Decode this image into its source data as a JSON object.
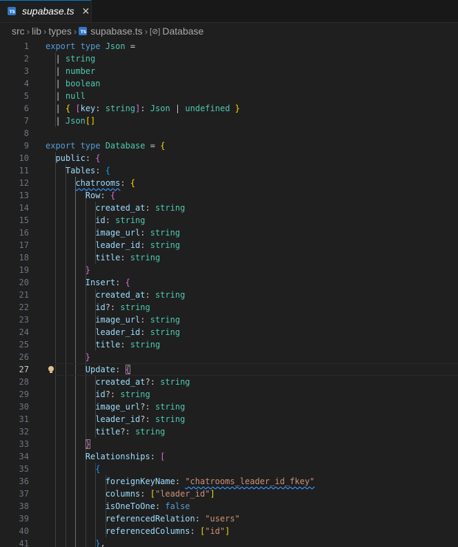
{
  "tab": {
    "title": "supabase.ts",
    "close": "✕",
    "file_icon": "TS"
  },
  "breadcrumb": {
    "items": [
      "src",
      "lib",
      "types",
      "supabase.ts",
      "Database"
    ],
    "symbol_icon": "[⊘]"
  },
  "editor": {
    "current_line": 27,
    "lines": [
      {
        "n": "1",
        "t": [
          [
            "kw",
            "export "
          ],
          [
            "kw",
            "type "
          ],
          [
            "ty",
            "Json"
          ],
          [
            "pu",
            " ="
          ]
        ]
      },
      {
        "n": "2",
        "t": [
          [
            "pu",
            "  | "
          ],
          [
            "ty",
            "string"
          ]
        ]
      },
      {
        "n": "3",
        "t": [
          [
            "pu",
            "  | "
          ],
          [
            "ty",
            "number"
          ]
        ]
      },
      {
        "n": "4",
        "t": [
          [
            "pu",
            "  | "
          ],
          [
            "ty",
            "boolean"
          ]
        ]
      },
      {
        "n": "5",
        "t": [
          [
            "pu",
            "  | "
          ],
          [
            "ty",
            "null"
          ]
        ]
      },
      {
        "n": "6",
        "t": [
          [
            "pu",
            "  | "
          ],
          [
            "b1",
            "{"
          ],
          [
            "pu",
            " "
          ],
          [
            "b2",
            "["
          ],
          [
            "pr",
            "key"
          ],
          [
            "pu",
            ": "
          ],
          [
            "ty",
            "string"
          ],
          [
            "b2",
            "]"
          ],
          [
            "pu",
            ": "
          ],
          [
            "ty",
            "Json"
          ],
          [
            "pu",
            " | "
          ],
          [
            "ty",
            "undefined"
          ],
          [
            "pu",
            " "
          ],
          [
            "b1",
            "}"
          ]
        ]
      },
      {
        "n": "7",
        "t": [
          [
            "pu",
            "  | "
          ],
          [
            "ty",
            "Json"
          ],
          [
            "b1",
            "[]"
          ]
        ]
      },
      {
        "n": "8",
        "t": []
      },
      {
        "n": "9",
        "t": [
          [
            "kw",
            "export "
          ],
          [
            "kw",
            "type "
          ],
          [
            "ty",
            "Database"
          ],
          [
            "pu",
            " = "
          ],
          [
            "b1",
            "{"
          ]
        ]
      },
      {
        "n": "10",
        "t": [
          [
            "pu",
            "  "
          ],
          [
            "pr",
            "public"
          ],
          [
            "pu",
            ": "
          ],
          [
            "b2",
            "{"
          ]
        ]
      },
      {
        "n": "11",
        "t": [
          [
            "pu",
            "    "
          ],
          [
            "pr",
            "Tables"
          ],
          [
            "pu",
            ": "
          ],
          [
            "b3",
            "{"
          ]
        ]
      },
      {
        "n": "12",
        "t": [
          [
            "pu",
            "      "
          ],
          [
            "pr wavy",
            "chatrooms"
          ],
          [
            "pu",
            ": "
          ],
          [
            "b1",
            "{"
          ]
        ]
      },
      {
        "n": "13",
        "t": [
          [
            "pu",
            "        "
          ],
          [
            "pr",
            "Row"
          ],
          [
            "pu",
            ": "
          ],
          [
            "b2",
            "{"
          ]
        ]
      },
      {
        "n": "14",
        "t": [
          [
            "pu",
            "          "
          ],
          [
            "pr",
            "created_at"
          ],
          [
            "pu",
            ": "
          ],
          [
            "ty",
            "string"
          ]
        ]
      },
      {
        "n": "15",
        "t": [
          [
            "pu",
            "          "
          ],
          [
            "pr",
            "id"
          ],
          [
            "pu",
            ": "
          ],
          [
            "ty",
            "string"
          ]
        ]
      },
      {
        "n": "16",
        "t": [
          [
            "pu",
            "          "
          ],
          [
            "pr",
            "image_url"
          ],
          [
            "pu",
            ": "
          ],
          [
            "ty",
            "string"
          ]
        ]
      },
      {
        "n": "17",
        "t": [
          [
            "pu",
            "          "
          ],
          [
            "pr",
            "leader_id"
          ],
          [
            "pu",
            ": "
          ],
          [
            "ty",
            "string"
          ]
        ]
      },
      {
        "n": "18",
        "t": [
          [
            "pu",
            "          "
          ],
          [
            "pr",
            "title"
          ],
          [
            "pu",
            ": "
          ],
          [
            "ty",
            "string"
          ]
        ]
      },
      {
        "n": "19",
        "t": [
          [
            "pu",
            "        "
          ],
          [
            "b2",
            "}"
          ]
        ]
      },
      {
        "n": "20",
        "t": [
          [
            "pu",
            "        "
          ],
          [
            "pr",
            "Insert"
          ],
          [
            "pu",
            ": "
          ],
          [
            "b2",
            "{"
          ]
        ]
      },
      {
        "n": "21",
        "t": [
          [
            "pu",
            "          "
          ],
          [
            "pr",
            "created_at"
          ],
          [
            "pu",
            ": "
          ],
          [
            "ty",
            "string"
          ]
        ]
      },
      {
        "n": "22",
        "t": [
          [
            "pu",
            "          "
          ],
          [
            "pr",
            "id"
          ],
          [
            "pu",
            "?: "
          ],
          [
            "ty",
            "string"
          ]
        ]
      },
      {
        "n": "23",
        "t": [
          [
            "pu",
            "          "
          ],
          [
            "pr",
            "image_url"
          ],
          [
            "pu",
            ": "
          ],
          [
            "ty",
            "string"
          ]
        ]
      },
      {
        "n": "24",
        "t": [
          [
            "pu",
            "          "
          ],
          [
            "pr",
            "leader_id"
          ],
          [
            "pu",
            ": "
          ],
          [
            "ty",
            "string"
          ]
        ]
      },
      {
        "n": "25",
        "t": [
          [
            "pu",
            "          "
          ],
          [
            "pr",
            "title"
          ],
          [
            "pu",
            ": "
          ],
          [
            "ty",
            "string"
          ]
        ]
      },
      {
        "n": "26",
        "t": [
          [
            "pu",
            "        "
          ],
          [
            "b2",
            "}"
          ]
        ]
      },
      {
        "n": "27",
        "t": [
          [
            "pu",
            "        "
          ],
          [
            "pr",
            "Update"
          ],
          [
            "pu",
            ": "
          ],
          [
            "b2 bm",
            "{"
          ]
        ]
      },
      {
        "n": "28",
        "t": [
          [
            "pu",
            "          "
          ],
          [
            "pr",
            "created_at"
          ],
          [
            "pu",
            "?: "
          ],
          [
            "ty",
            "string"
          ]
        ]
      },
      {
        "n": "29",
        "t": [
          [
            "pu",
            "          "
          ],
          [
            "pr",
            "id"
          ],
          [
            "pu",
            "?: "
          ],
          [
            "ty",
            "string"
          ]
        ]
      },
      {
        "n": "30",
        "t": [
          [
            "pu",
            "          "
          ],
          [
            "pr",
            "image_url"
          ],
          [
            "pu",
            "?: "
          ],
          [
            "ty",
            "string"
          ]
        ]
      },
      {
        "n": "31",
        "t": [
          [
            "pu",
            "          "
          ],
          [
            "pr",
            "leader_id"
          ],
          [
            "pu",
            "?: "
          ],
          [
            "ty",
            "string"
          ]
        ]
      },
      {
        "n": "32",
        "t": [
          [
            "pu",
            "          "
          ],
          [
            "pr",
            "title"
          ],
          [
            "pu",
            "?: "
          ],
          [
            "ty",
            "string"
          ]
        ]
      },
      {
        "n": "33",
        "t": [
          [
            "pu",
            "        "
          ],
          [
            "b2 bm",
            "}"
          ]
        ]
      },
      {
        "n": "34",
        "t": [
          [
            "pu",
            "        "
          ],
          [
            "pr",
            "Relationships"
          ],
          [
            "pu",
            ": "
          ],
          [
            "b2",
            "["
          ]
        ]
      },
      {
        "n": "35",
        "t": [
          [
            "pu",
            "          "
          ],
          [
            "b3",
            "{"
          ]
        ]
      },
      {
        "n": "36",
        "t": [
          [
            "pu",
            "            "
          ],
          [
            "pr",
            "foreignKeyName"
          ],
          [
            "pu",
            ": "
          ],
          [
            "s wavy",
            "\"chatrooms_leader_id_fkey\""
          ]
        ]
      },
      {
        "n": "37",
        "t": [
          [
            "pu",
            "            "
          ],
          [
            "pr",
            "columns"
          ],
          [
            "pu",
            ": "
          ],
          [
            "b1",
            "["
          ],
          [
            "s",
            "\"leader_id\""
          ],
          [
            "b1",
            "]"
          ]
        ]
      },
      {
        "n": "38",
        "t": [
          [
            "pu",
            "            "
          ],
          [
            "pr",
            "isOneToOne"
          ],
          [
            "pu",
            ": "
          ],
          [
            "kw",
            "false"
          ]
        ]
      },
      {
        "n": "39",
        "t": [
          [
            "pu",
            "            "
          ],
          [
            "pr",
            "referencedRelation"
          ],
          [
            "pu",
            ": "
          ],
          [
            "s",
            "\"users\""
          ]
        ]
      },
      {
        "n": "40",
        "t": [
          [
            "pu",
            "            "
          ],
          [
            "pr",
            "referencedColumns"
          ],
          [
            "pu",
            ": "
          ],
          [
            "b1",
            "["
          ],
          [
            "s",
            "\"id\""
          ],
          [
            "b1",
            "]"
          ]
        ]
      },
      {
        "n": "41",
        "t": [
          [
            "pu",
            "          "
          ],
          [
            "b3",
            "}"
          ],
          [
            "pu",
            ","
          ]
        ]
      }
    ]
  }
}
